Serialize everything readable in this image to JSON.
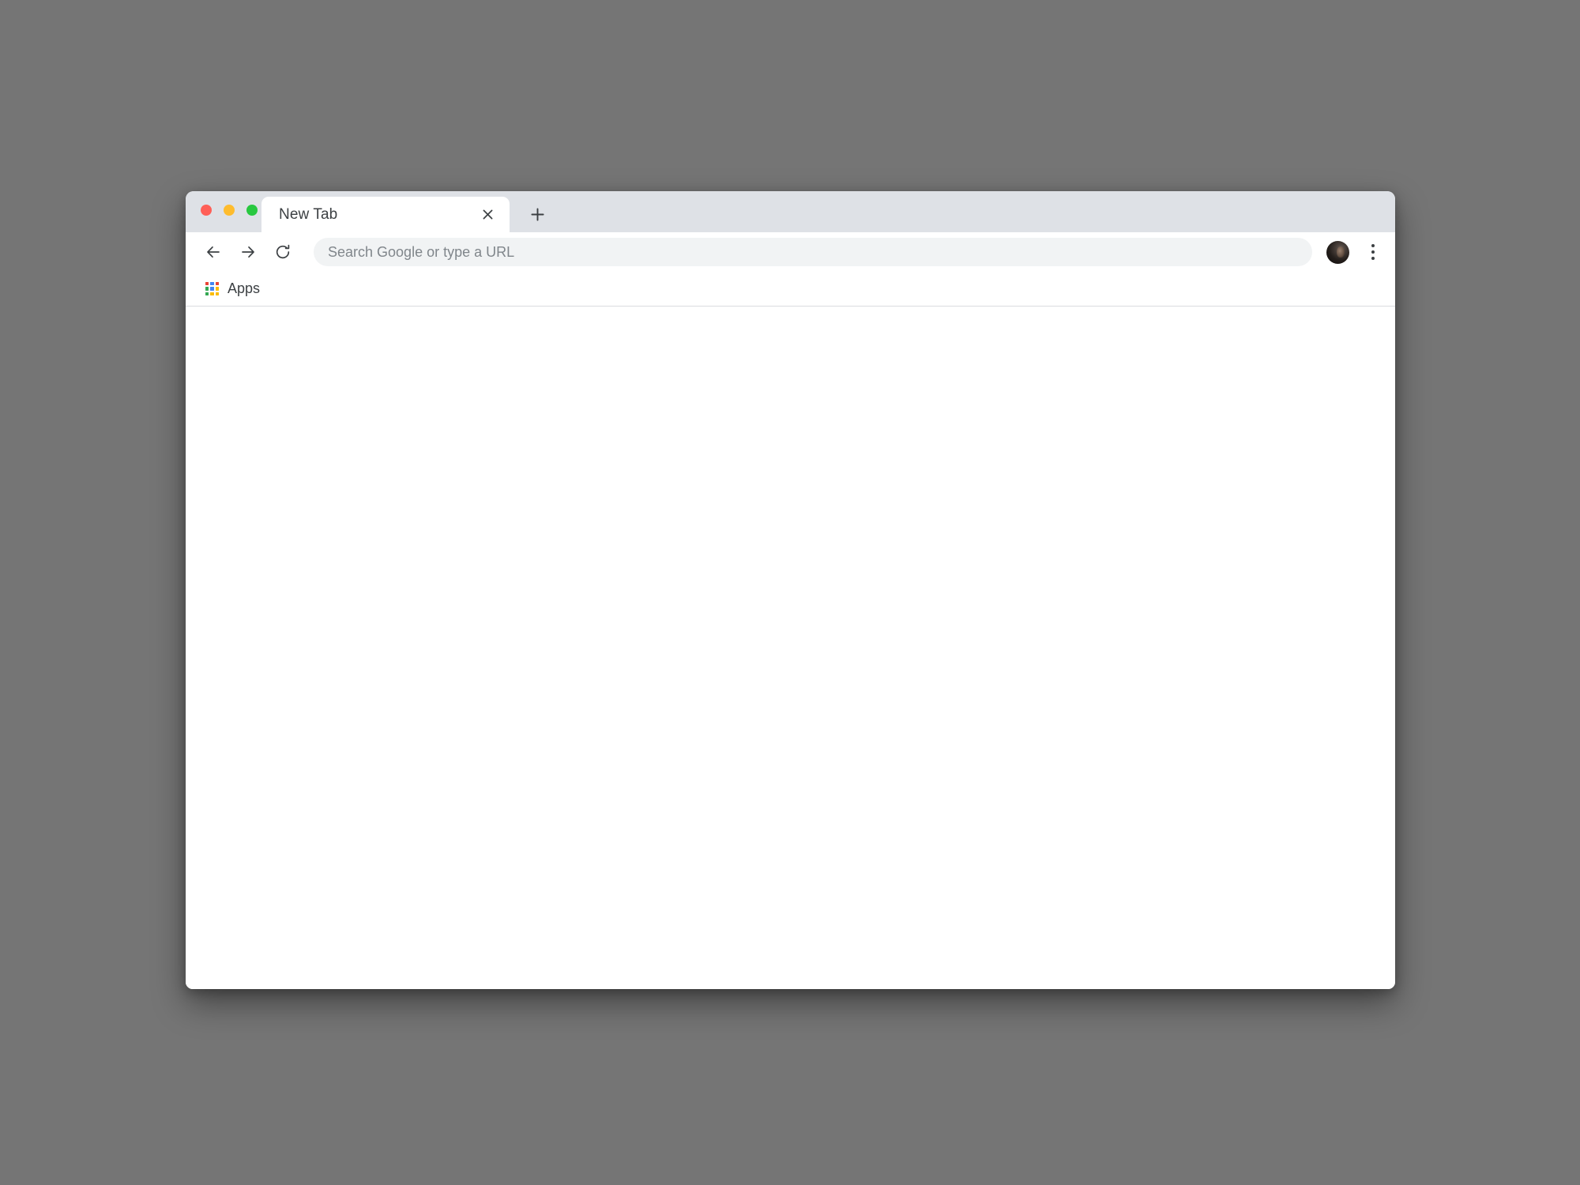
{
  "desktop": {
    "background_color": "#757575"
  },
  "window": {
    "controls": [
      {
        "name": "close",
        "color": "#ff5f57"
      },
      {
        "name": "minimize",
        "color": "#febc2e"
      },
      {
        "name": "maximize",
        "color": "#28c840"
      }
    ],
    "tabstrip_color": "#dee1e6"
  },
  "tabs": [
    {
      "title": "New Tab",
      "active": true,
      "close_icon": "close-icon"
    }
  ],
  "new_tab": {
    "icon": "plus-icon",
    "tooltip": "New Tab"
  },
  "toolbar": {
    "back": {
      "icon": "arrow-left-icon",
      "label": "Back"
    },
    "forward": {
      "icon": "arrow-right-icon",
      "label": "Forward"
    },
    "reload": {
      "icon": "reload-icon",
      "label": "Reload"
    },
    "address": {
      "value": "",
      "placeholder": "Search Google or type a URL"
    },
    "profile": {
      "icon": "avatar",
      "label": "Profile"
    },
    "menu": {
      "icon": "three-dots-vertical-icon",
      "label": "Customize and control"
    }
  },
  "bookmarks_bar": {
    "items": [
      {
        "label": "Apps",
        "icon": "apps-grid-icon"
      }
    ],
    "apps_icon_colors": [
      "#ea4335",
      "#4285f4",
      "#ea4335",
      "#34a853",
      "#4285f4",
      "#fbbc04",
      "#34a853",
      "#fbbc04",
      "#fbbc04"
    ]
  },
  "page": {
    "content": "",
    "background_color": "#ffffff"
  }
}
